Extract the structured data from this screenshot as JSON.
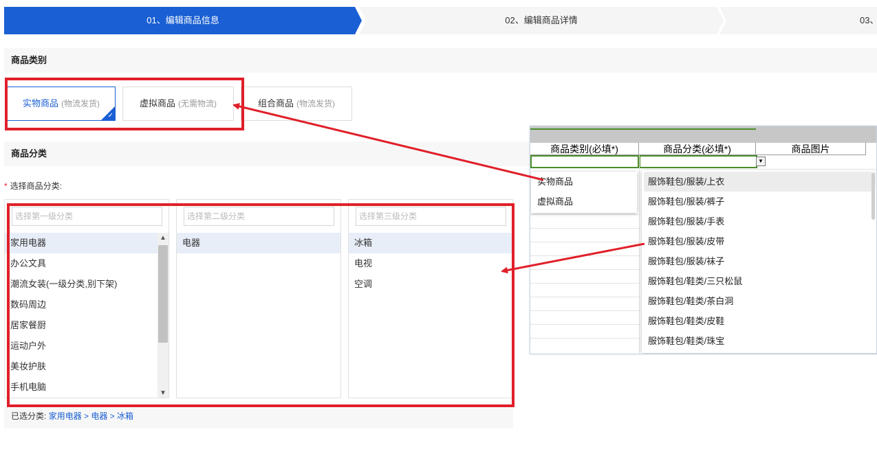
{
  "steps": [
    {
      "label": "01、编辑商品信息"
    },
    {
      "label": "02、编辑商品详情"
    },
    {
      "label": "03、"
    }
  ],
  "sections": {
    "type_title": "商品类别",
    "category_title": "商品分类"
  },
  "types": [
    {
      "label": "实物商品",
      "sub": "(物流发货)"
    },
    {
      "label": "虚拟商品",
      "sub": "(无需物流)"
    },
    {
      "label": "组合商品",
      "sub": "(物流发货)"
    }
  ],
  "category": {
    "label": "选择商品分类:",
    "required_mark": "*",
    "col1": {
      "placeholder": "选择第一级分类",
      "items": [
        "家用电器",
        "办公文具",
        "潮流女装(一级分类,别下架)",
        "数码周边",
        "居家餐厨",
        "运动户外",
        "美妆护肤",
        "手机电脑"
      ]
    },
    "col2": {
      "placeholder": "选择第二级分类",
      "items": [
        "电器"
      ]
    },
    "col3": {
      "placeholder": "选择第三级分类",
      "items": [
        "冰箱",
        "电视",
        "空调"
      ]
    },
    "selected_label": "已选分类:",
    "selected_path": "家用电器 > 电器 > 冰箱"
  },
  "sheet": {
    "headers": [
      "商品类别(必填*)",
      "商品分类(必填*)",
      "商品图片"
    ],
    "type_options": [
      "实物商品",
      "虚拟商品"
    ],
    "category_options": [
      "服饰鞋包/服装/上衣",
      "服饰鞋包/服装/裤子",
      "服饰鞋包/服装/手表",
      "服饰鞋包/服装/皮带",
      "服饰鞋包/服装/袜子",
      "服饰鞋包/鞋类/三只松鼠",
      "服饰鞋包/鞋类/茶白洞",
      "服饰鞋包/鞋类/皮鞋",
      "服饰鞋包/鞋类/珠宝"
    ]
  },
  "colors": {
    "primary": "#1a5fd3",
    "annotation": "#e0202a",
    "excel_green": "#4a8c2a"
  }
}
